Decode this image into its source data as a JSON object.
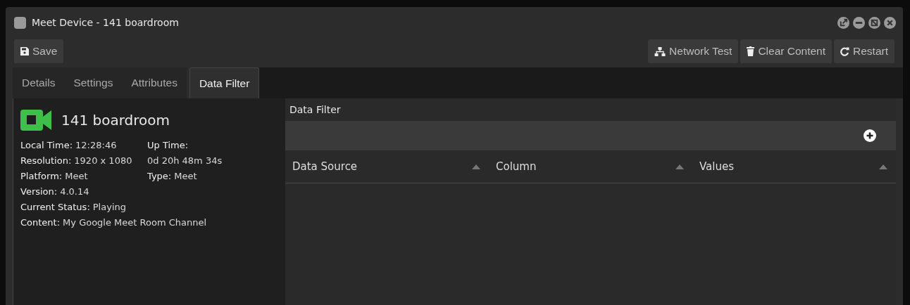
{
  "window": {
    "title": "Meet Device - 141 boardroom"
  },
  "toolbar": {
    "left": [
      {
        "label": "Save",
        "kind": "save"
      }
    ],
    "right": [
      {
        "label": "Network Test",
        "kind": "network"
      },
      {
        "label": "Clear Content",
        "kind": "trash"
      },
      {
        "label": "Restart",
        "kind": "restart"
      }
    ]
  },
  "tabs": [
    {
      "label": "Details",
      "selected": false
    },
    {
      "label": "Settings",
      "selected": false
    },
    {
      "label": "Attributes",
      "selected": false
    },
    {
      "label": "Data Filter",
      "selected": true
    }
  ],
  "device": {
    "name": "141 boardroom",
    "left": [
      {
        "label": "Local Time:",
        "value": "12:28:46"
      },
      {
        "label": "Resolution:",
        "value": "1920 x 1080"
      },
      {
        "label": "Platform:",
        "value": "Meet"
      },
      {
        "label": "Version:",
        "value": "4.0.14"
      },
      {
        "label": "Current Status:",
        "value": "Playing"
      },
      {
        "label": "Content:",
        "value": "My Google Meet Room Channel"
      }
    ],
    "right": [
      {
        "label": "Up Time:",
        "value": "0d 20h 48m 34s"
      },
      {
        "label": "Type:",
        "value": "Meet"
      }
    ]
  },
  "filter": {
    "title": "Data Filter",
    "columns": [
      "Data Source",
      "Column",
      "Values"
    ]
  }
}
